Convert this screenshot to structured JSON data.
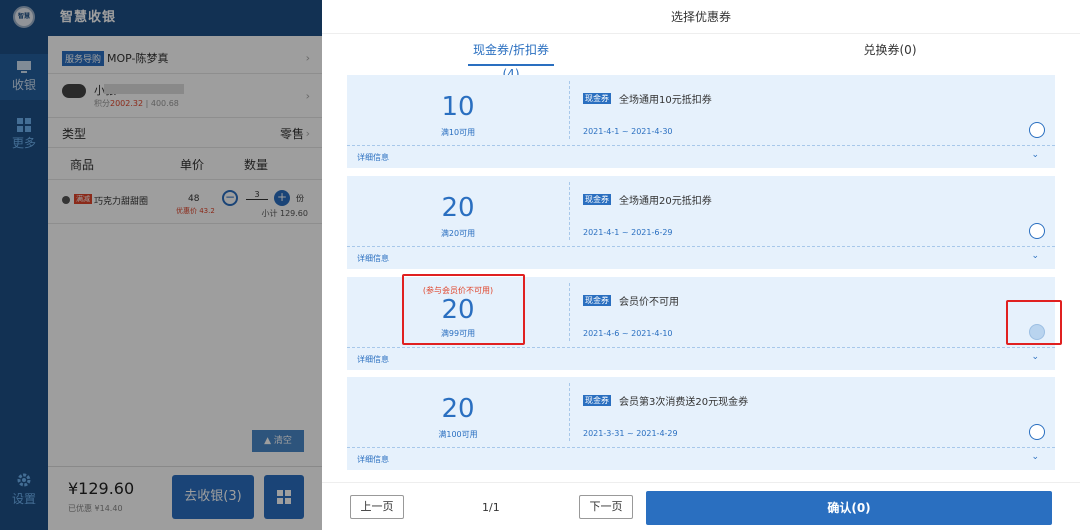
{
  "rail": {
    "logo": "智慧",
    "nav_checkout": "收银",
    "nav_more": "更多",
    "nav_settings": "设置"
  },
  "pos": {
    "app_title": "智慧收银",
    "guide_tag": "服务导购",
    "guide_name": "MOP-陈梦真",
    "member_name": "小张",
    "member_points_label": "积分",
    "member_points_value": "2002.32",
    "member_balance": "400.68",
    "type_label": "类型",
    "type_value": "零售",
    "col_product": "商品",
    "col_price": "单价",
    "col_qty": "数量",
    "item": {
      "badge": "满减",
      "name": "巧克力甜甜圈",
      "price": "48",
      "member_price": "优惠价 43.2",
      "qty": "3",
      "unit": "份",
      "subtotal": "小计 129.60"
    },
    "clear_label": "清空",
    "total": "¥129.60",
    "discount": "已优惠 ¥14.40",
    "pay_label": "去收银(3)"
  },
  "modal": {
    "title": "选择优惠券",
    "tabs": [
      {
        "label": "现金券/折扣券(4)",
        "active": true
      },
      {
        "label": "兑换券(0)",
        "active": false
      }
    ],
    "coupons": [
      {
        "note": "",
        "amount": "10",
        "condition": "满10可用",
        "type": "现金券",
        "name": "全场通用10元抵扣券",
        "dates": "2021-4-1 ~ 2021-4-30",
        "detail": "详细信息",
        "disabled": false
      },
      {
        "note": "",
        "amount": "20",
        "condition": "满20可用",
        "type": "现金券",
        "name": "全场通用20元抵扣券",
        "dates": "2021-4-1 ~ 2021-6-29",
        "detail": "详细信息",
        "disabled": false
      },
      {
        "note": "(参与会员价不可用)",
        "amount": "20",
        "condition": "满99可用",
        "type": "现金券",
        "name": "会员价不可用",
        "dates": "2021-4-6 ~ 2021-4-10",
        "detail": "详细信息",
        "disabled": true
      },
      {
        "note": "",
        "amount": "20",
        "condition": "满100可用",
        "type": "现金券",
        "name": "会员第3次消费送20元现金券",
        "dates": "2021-3-31 ~ 2021-4-29",
        "detail": "详细信息",
        "disabled": false
      }
    ],
    "prev_label": "上一页",
    "page": "1/1",
    "next_label": "下一页",
    "confirm_label": "确认(0)"
  },
  "colors": {
    "accent": "#2a6fc0",
    "nav_bg": "#1d4f86",
    "coupon_bg": "#e6f1fc",
    "warning": "#e0452b",
    "highlight": "#e02020"
  }
}
